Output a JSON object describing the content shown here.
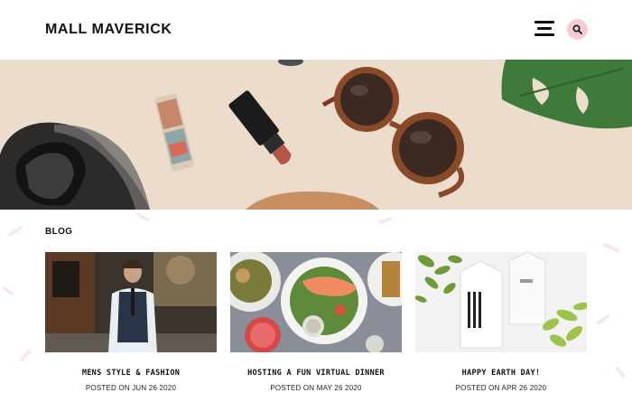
{
  "header": {
    "logo": "MALL MAVERICK",
    "menu_icon": "hamburger-menu-icon",
    "search_icon": "search-icon"
  },
  "hero": {
    "image": "flat-lay-sneaker-lipstick-sunglasses-leaf"
  },
  "blog": {
    "section_title": "BLOG",
    "posts": [
      {
        "title": "MENS STYLE & FASHION",
        "date": "POSTED ON JUN 26 2020"
      },
      {
        "title": "HOSTING A FUN VIRTUAL DINNER",
        "date": "POSTED ON MAY 26 2020"
      },
      {
        "title": "HAPPY EARTH DAY!",
        "date": "POSTED ON APR 26 2020"
      }
    ]
  },
  "colors": {
    "search_bg": "#f4cdd3",
    "hero_bg": "#ecdccc",
    "text": "#111111"
  }
}
